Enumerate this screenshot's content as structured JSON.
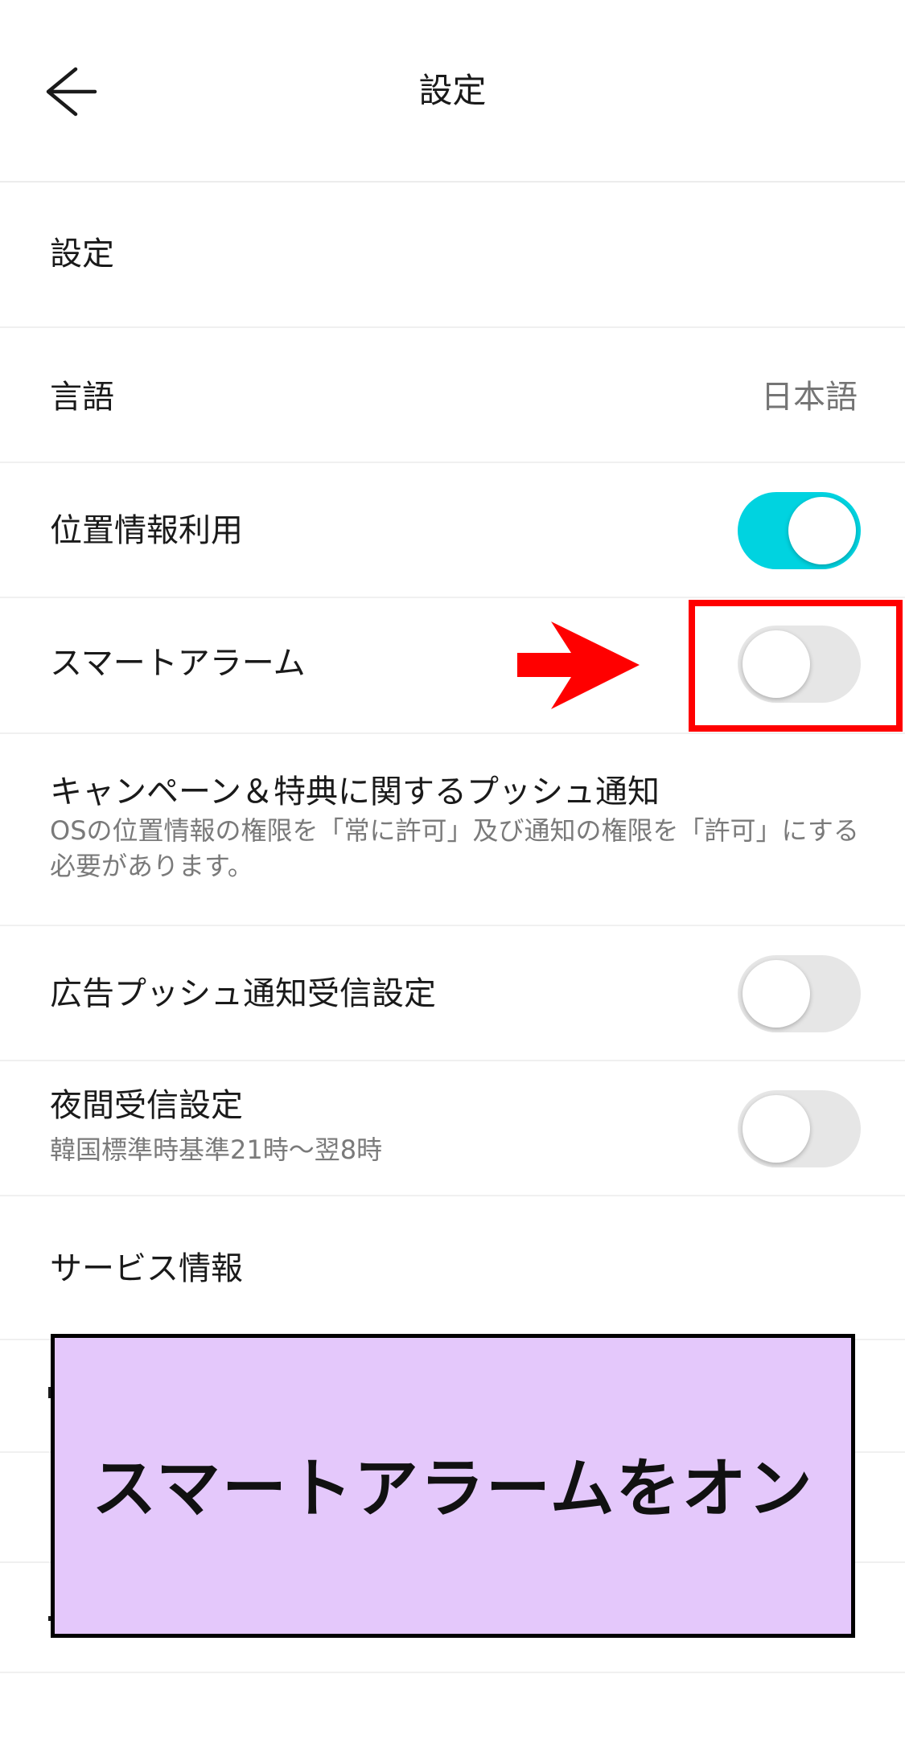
{
  "header": {
    "title": "設定"
  },
  "rows": {
    "settings_section": {
      "label": "設定"
    },
    "language": {
      "label": "言語",
      "value": "日本語"
    },
    "location": {
      "label": "位置情報利用",
      "toggle": "on"
    },
    "smart_alarm": {
      "label": "スマートアラーム",
      "toggle": "off"
    },
    "campaign_push": {
      "label": "キャンペーン＆特典に関するプッシュ通知",
      "sub": "OSの位置情報の権限を「常に許可」及び通知の権限を「許可」にする必要があります。"
    },
    "ad_push": {
      "label": "広告プッシュ通知受信設定",
      "toggle": "off"
    },
    "night": {
      "label": "夜間受信設定",
      "sub": "韓国標準時基準21時〜翌8時",
      "toggle": "off"
    },
    "service_info": {
      "label": "サービス情報"
    }
  },
  "annotation": {
    "overlay_text": "スマートアラームをオン",
    "highlight_color": "#ff0000",
    "overlay_color": "#e4c8fb",
    "arrow_icon": "red-right-arrow"
  },
  "colors": {
    "toggle_on": "#00d3e0",
    "toggle_off": "#e6e6e6"
  }
}
